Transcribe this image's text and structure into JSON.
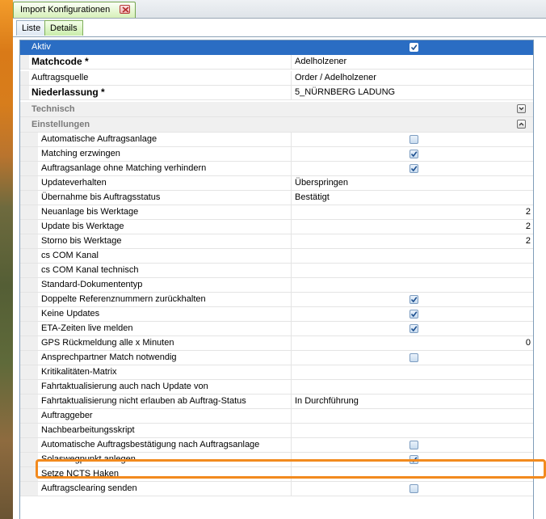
{
  "window": {
    "doc_tab_title": "Import Konfigurationen",
    "sub_tabs": [
      "Liste",
      "Details"
    ]
  },
  "grid": {
    "top_rows": [
      {
        "label": "Aktiv",
        "type": "checkbox",
        "checked": true,
        "selected": true,
        "bold": false
      },
      {
        "label": "Matchcode *",
        "type": "text",
        "value": "Adelholzener",
        "bold": true
      },
      {
        "label": "Auftragsquelle",
        "type": "text",
        "value": "Order / Adelholzener",
        "bold": false
      },
      {
        "label": "Niederlassung *",
        "type": "text",
        "value": "5_NÜRNBERG LADUNG",
        "bold": true
      }
    ],
    "categories": [
      {
        "label": "Technisch",
        "expanded": false,
        "toggle_icon": "chevron-down-icon"
      },
      {
        "label": "Einstellungen",
        "expanded": true,
        "toggle_icon": "chevron-up-icon"
      }
    ],
    "settings_rows": [
      {
        "label": "Automatische Auftragsanlage",
        "type": "checkbox",
        "checked": false
      },
      {
        "label": "Matching erzwingen",
        "type": "checkbox",
        "checked": true
      },
      {
        "label": "Auftragsanlage ohne Matching verhindern",
        "type": "checkbox",
        "checked": true
      },
      {
        "label": "Updateverhalten",
        "type": "text",
        "value": "Überspringen"
      },
      {
        "label": "Übernahme bis Auftragsstatus",
        "type": "text",
        "value": "Bestätigt"
      },
      {
        "label": "Neuanlage bis Werktage",
        "type": "number",
        "value": "2"
      },
      {
        "label": "Update bis Werktage",
        "type": "number",
        "value": "2"
      },
      {
        "label": "Storno bis Werktage",
        "type": "number",
        "value": "2"
      },
      {
        "label": "cs COM Kanal",
        "type": "text",
        "value": ""
      },
      {
        "label": "cs COM Kanal technisch",
        "type": "text",
        "value": ""
      },
      {
        "label": "Standard-Dokumententyp",
        "type": "text",
        "value": ""
      },
      {
        "label": "Doppelte Referenznummern zurückhalten",
        "type": "checkbox",
        "checked": true
      },
      {
        "label": "Keine Updates",
        "type": "checkbox",
        "checked": true
      },
      {
        "label": "ETA-Zeiten live melden",
        "type": "checkbox",
        "checked": true
      },
      {
        "label": "GPS Rückmeldung alle x Minuten",
        "type": "number",
        "value": "0"
      },
      {
        "label": "Ansprechpartner Match notwendig",
        "type": "checkbox",
        "checked": false
      },
      {
        "label": "Kritikalitäten-Matrix",
        "type": "text",
        "value": ""
      },
      {
        "label": "Fahrtaktualisierung auch nach Update von",
        "type": "text",
        "value": ""
      },
      {
        "label": "Fahrtaktualisierung nicht erlauben ab Auftrag-Status",
        "type": "text",
        "value": "In Durchführung"
      },
      {
        "label": "Auftraggeber",
        "type": "text",
        "value": ""
      },
      {
        "label": "Nachbearbeitungsskript",
        "type": "text",
        "value": ""
      },
      {
        "label": "Automatische Auftragsbestätigung nach Auftragsanlage",
        "type": "checkbox",
        "checked": false
      },
      {
        "label": "Solaswegpunkt anlegen",
        "type": "checkbox",
        "checked": true,
        "highlighted": true
      },
      {
        "label": "Setze NCTS Haken",
        "type": "text",
        "value": ""
      },
      {
        "label": "Auftragsclearing senden",
        "type": "checkbox",
        "checked": false
      }
    ]
  },
  "colors": {
    "selection": "#2a6dc3",
    "highlight_border": "#f28a1e",
    "category_text": "#7a7a7a"
  }
}
